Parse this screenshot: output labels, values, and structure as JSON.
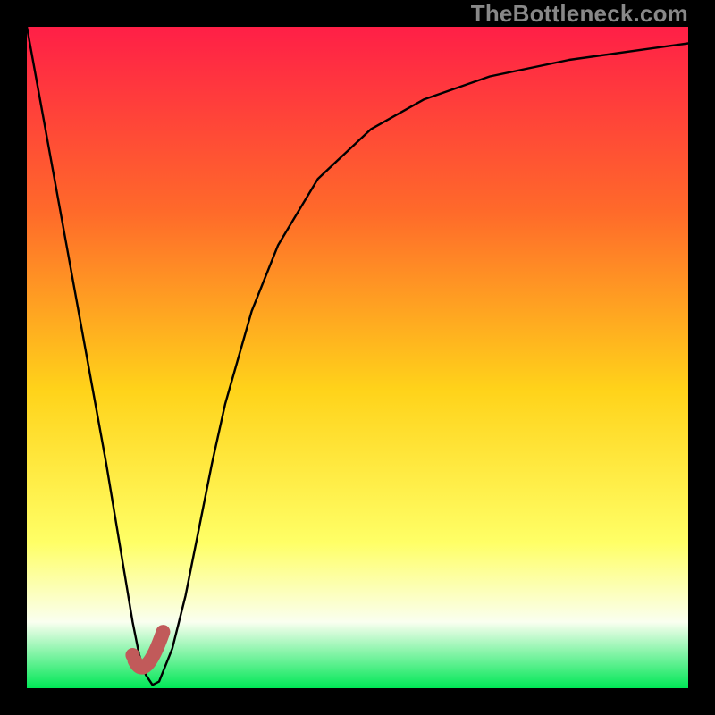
{
  "watermark": "TheBottleneck.com",
  "colors": {
    "frame": "#000000",
    "gradient_top": "#ff1f47",
    "gradient_mid1": "#ff6a2a",
    "gradient_mid2": "#ffd31a",
    "gradient_mid3": "#ffff66",
    "gradient_mid4": "#fafff0",
    "gradient_bottom": "#00e756",
    "curve": "#000000",
    "marker_stroke": "#c15a5a",
    "marker_fill": "#c15a5a"
  },
  "chart_data": {
    "type": "line",
    "title": "",
    "xlabel": "",
    "ylabel": "",
    "xlim": [
      0,
      100
    ],
    "ylim": [
      0,
      100
    ],
    "series": [
      {
        "name": "bottleneck-curve",
        "x": [
          0,
          2,
          4,
          6,
          8,
          10,
          12,
          14,
          15,
          16,
          17,
          18,
          19,
          20,
          22,
          24,
          26,
          28,
          30,
          34,
          38,
          44,
          52,
          60,
          70,
          82,
          100
        ],
        "y": [
          100,
          89,
          78,
          67,
          56,
          45,
          34,
          22,
          16,
          10,
          5,
          2,
          0.5,
          1,
          6,
          14,
          24,
          34,
          43,
          57,
          67,
          77,
          84.5,
          89,
          92.5,
          95,
          97.5
        ]
      }
    ],
    "marker": {
      "name": "optimal-point-J",
      "x": 18.2,
      "y": 1.4,
      "J_tail_start": {
        "x": 16.3,
        "y": 4.2
      },
      "J_tail_mid": {
        "x": 17.9,
        "y": 0.8
      },
      "J_tail_end": {
        "x": 20.6,
        "y": 8.5
      },
      "dot": {
        "x": 16.0,
        "y": 5.0
      }
    },
    "notes": "y-axis inverted visually (0 at bottom = green/good, 100 at top = red/bad). Curve shows bottleneck %: steep drop from top-left to minimum near x≈18, then asymptotic rise toward ~97 at right."
  }
}
